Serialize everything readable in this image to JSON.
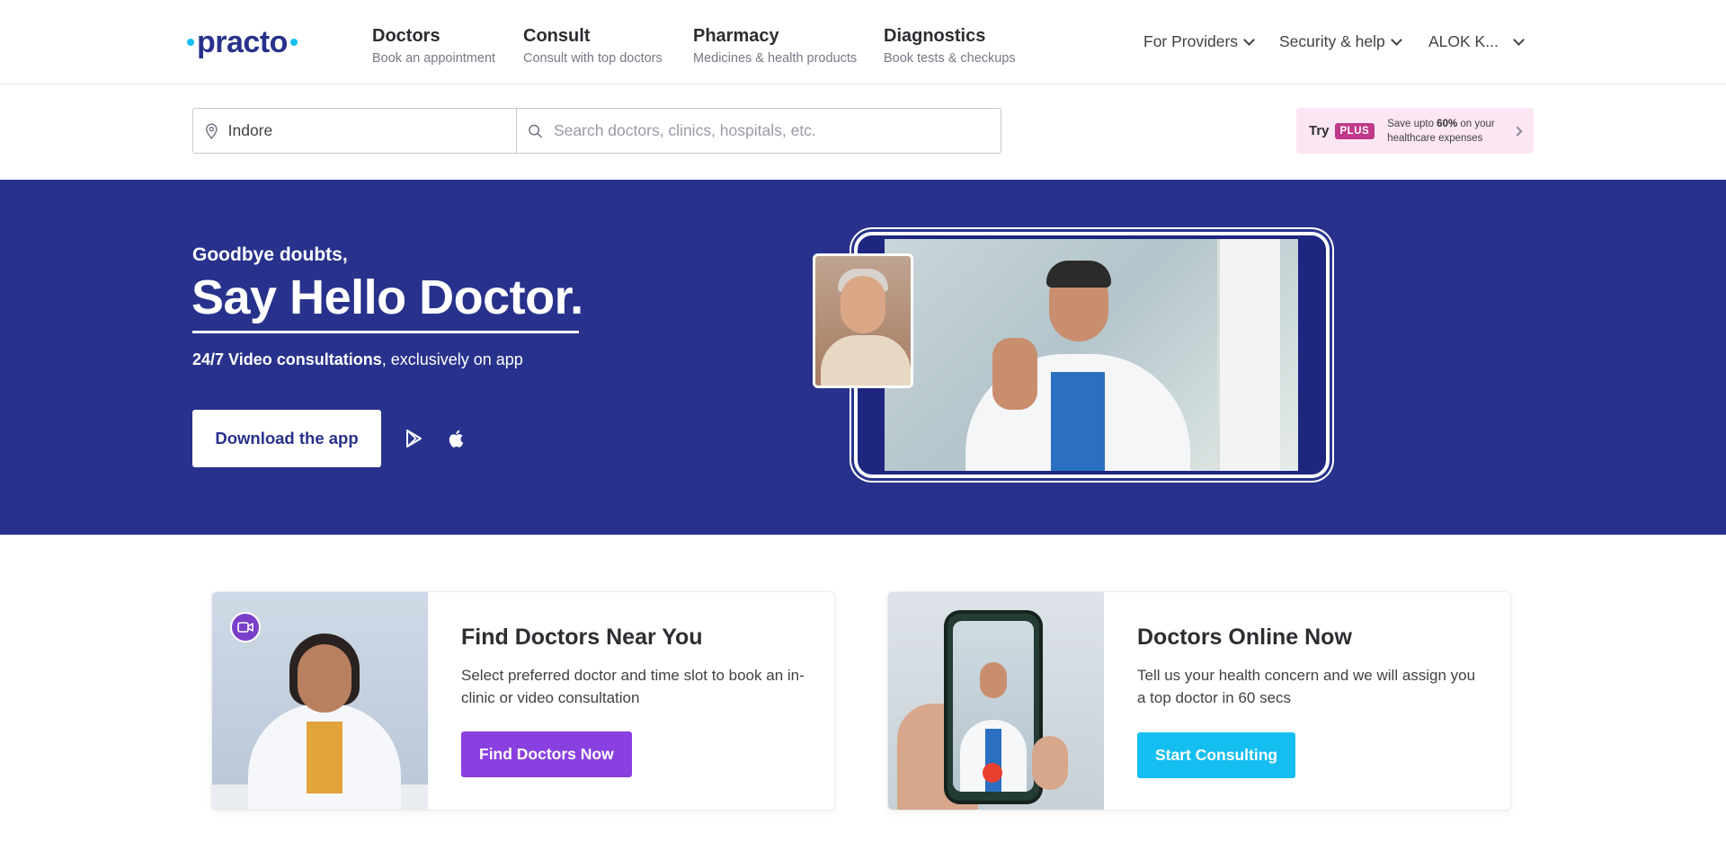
{
  "brand": {
    "logo_text": "practo",
    "accent": "#14bef0",
    "primary": "#28328c"
  },
  "nav": {
    "items": [
      {
        "title": "Doctors",
        "sub": "Book an appointment"
      },
      {
        "title": "Consult",
        "sub": "Consult with top doctors"
      },
      {
        "title": "Pharmacy",
        "sub": "Medicines & health products"
      },
      {
        "title": "Diagnostics",
        "sub": "Book tests & checkups"
      }
    ],
    "for_providers": "For Providers",
    "security_help": "Security & help",
    "user": "ALOK K..."
  },
  "search": {
    "location_value": "Indore",
    "query_placeholder": "Search doctors, clinics, hospitals, etc.",
    "location_icon": "location-pin-icon",
    "search_icon": "search-icon"
  },
  "plus_promo": {
    "try_label": "Try",
    "badge": "PLUS",
    "text_prefix": "Save upto ",
    "text_highlight": "60%",
    "text_suffix": " on your healthcare expenses"
  },
  "hero": {
    "kicker": "Goodbye doubts,",
    "title": "Say Hello Doctor.",
    "sub_bold": "24/7 Video consultations",
    "sub_rest": ", exclusively on app",
    "download_label": "Download the app",
    "store_icons": [
      "google-play-icon",
      "apple-icon"
    ],
    "bg_color": "#28328c"
  },
  "cards": [
    {
      "title": "Find Doctors Near You",
      "desc": "Select preferred doctor and time slot to book an in-clinic or video consultation",
      "button": "Find Doctors Now",
      "button_color": "#8a3fe0"
    },
    {
      "title": "Doctors Online Now",
      "desc": "Tell us your health concern and we will assign you a top doctor in 60 secs",
      "button": "Start Consulting",
      "button_color": "#14bef0"
    }
  ]
}
